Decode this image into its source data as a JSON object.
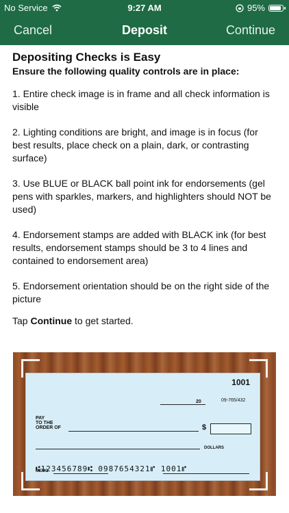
{
  "status_bar": {
    "carrier": "No Service",
    "time": "9:27 AM",
    "battery": "95%",
    "battery_level": 0.95
  },
  "nav": {
    "left": "Cancel",
    "title": "Deposit",
    "right": "Continue"
  },
  "content": {
    "title": "Depositing Checks is Easy",
    "subtitle": "Ensure the following quality controls are in place:",
    "items": [
      "1. Entire check image is in frame and all check information is visible",
      "2. Lighting conditions are bright, and image is in focus (for best results, place check on a plain, dark, or contrasting surface)",
      "3. Use BLUE or BLACK ball point ink for endorsements (gel pens with sparkles, markers, and highlighters should NOT be used)",
      "4. Endorsement stamps are added with BLACK ink (for best results, endorsement stamps should be 3 to 4 lines and contained to endorsement area)",
      "5. Endorsement orientation should be on the right side of the picture"
    ],
    "tap_prefix": "Tap ",
    "tap_bold": "Continue",
    "tap_suffix": " to get started."
  },
  "check": {
    "number": "1001",
    "date_label": "20",
    "routing_fraction": "09-765/432",
    "pay_label_1": "PAY",
    "pay_label_2": "TO THE",
    "pay_label_3": "ORDER OF",
    "dollar_sign": "$",
    "dollars_label": "DOLLARS",
    "memo_label": "MEMO",
    "micr": "⑆123456789⑆  0987654321⑈  1001⑈"
  }
}
